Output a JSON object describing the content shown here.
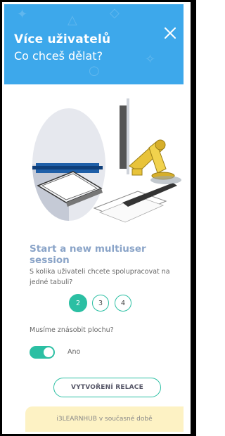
{
  "header": {
    "title": "Více uživatelů",
    "subtitle": "Co chceš dělat?",
    "background": "#3da8eb",
    "close_icon": "close-icon"
  },
  "session": {
    "title": "Start a new multiuser session",
    "question": "S kolika uživateli chcete spolupracovat na jedné tabuli?",
    "user_options": [
      "2",
      "3",
      "4"
    ],
    "selected_option": "2"
  },
  "multiply": {
    "question": "Musíme znásobit plochu?",
    "toggle_label": "Ano",
    "toggle_on": true
  },
  "create_button": {
    "label": "VYTVOŘENÍ RELACE"
  },
  "info_bar": {
    "text": "i3LEARNHUB v současné době"
  },
  "colors": {
    "accent": "#2bbfa3",
    "header": "#3da8eb",
    "title_text": "#8aa4c8",
    "info_bg": "#fdf2c4"
  }
}
